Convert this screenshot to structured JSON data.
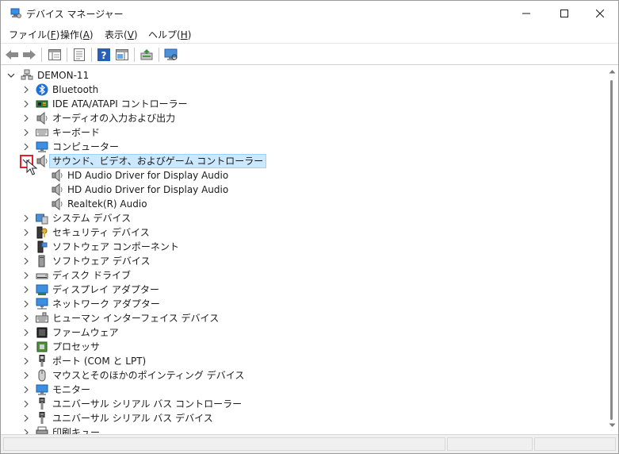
{
  "window": {
    "title": "デバイス マネージャー",
    "icon": "device-manager-icon"
  },
  "menu": [
    {
      "label": "ファイル(",
      "key": "F",
      "end": ")"
    },
    {
      "label": "操作(",
      "key": "A",
      "end": ")"
    },
    {
      "label": "表示(",
      "key": "V",
      "end": ")"
    },
    {
      "label": "ヘルプ(",
      "key": "H",
      "end": ")"
    }
  ],
  "toolbar": {
    "buttons": [
      "back-icon",
      "forward-icon",
      "show-hide-tree-icon",
      "properties-icon",
      "help-icon",
      "action-pane-icon",
      "update-driver-icon",
      "scan-hardware-icon"
    ]
  },
  "tree": {
    "root": "DEMON-11",
    "items": [
      {
        "label": "Bluetooth",
        "icon": "bluetooth-icon"
      },
      {
        "label": "IDE ATA/ATAPI コントローラー",
        "icon": "ide-controller-icon"
      },
      {
        "label": "オーディオの入力および出力",
        "icon": "speaker-icon"
      },
      {
        "label": "キーボード",
        "icon": "keyboard-icon"
      },
      {
        "label": "コンピューター",
        "icon": "computer-icon"
      },
      {
        "label": "サウンド、ビデオ、およびゲーム コントローラー",
        "icon": "speaker-icon",
        "expanded": true,
        "children": [
          "HD Audio Driver for Display Audio",
          "HD Audio Driver for Display Audio",
          "Realtek(R) Audio"
        ]
      },
      {
        "label": "システム デバイス",
        "icon": "system-device-icon"
      },
      {
        "label": "セキュリティ デバイス",
        "icon": "security-device-icon"
      },
      {
        "label": "ソフトウェア コンポーネント",
        "icon": "software-component-icon"
      },
      {
        "label": "ソフトウェア デバイス",
        "icon": "software-device-icon"
      },
      {
        "label": "ディスク ドライブ",
        "icon": "disk-drive-icon"
      },
      {
        "label": "ディスプレイ アダプター",
        "icon": "display-adapter-icon"
      },
      {
        "label": "ネットワーク アダプター",
        "icon": "network-adapter-icon"
      },
      {
        "label": "ヒューマン インターフェイス デバイス",
        "icon": "hid-icon"
      },
      {
        "label": "ファームウェア",
        "icon": "firmware-icon"
      },
      {
        "label": "プロセッサ",
        "icon": "processor-icon"
      },
      {
        "label": "ポート (COM と LPT)",
        "icon": "port-icon"
      },
      {
        "label": "マウスとそのほかのポインティング デバイス",
        "icon": "mouse-icon"
      },
      {
        "label": "モニター",
        "icon": "monitor-icon"
      },
      {
        "label": "ユニバーサル シリアル バス コントローラー",
        "icon": "usb-icon"
      },
      {
        "label": "ユニバーサル シリアル バス デバイス",
        "icon": "usb-icon"
      },
      {
        "label": "印刷キュー",
        "icon": "printer-icon"
      }
    ]
  },
  "colors": {
    "selection": "#cce8ff",
    "focus": "#e0202a"
  }
}
